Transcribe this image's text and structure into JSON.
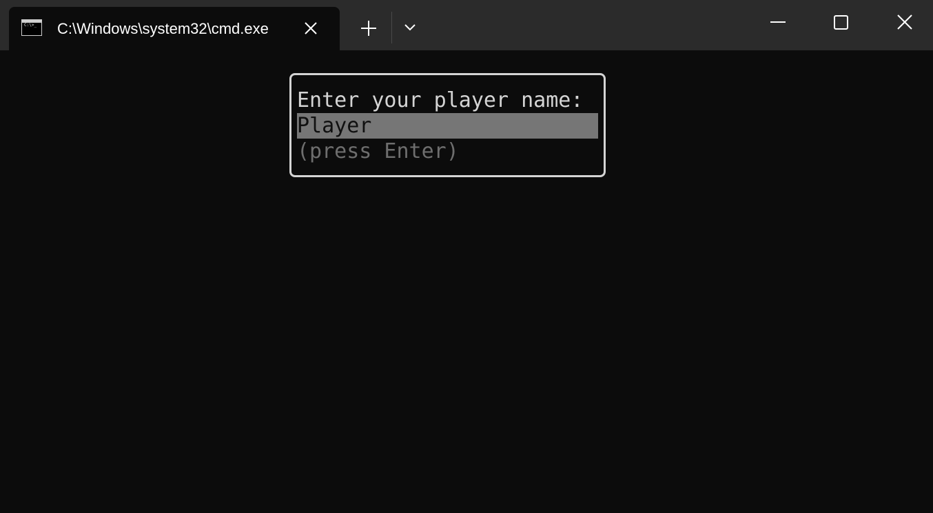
{
  "window": {
    "tab_title": "C:\\Windows\\system32\\cmd.exe",
    "tab_icon": "cmd-icon",
    "tab_icon_prompt": "C:\\>_",
    "new_tab_icon": "plus-icon",
    "dropdown_icon": "chevron-down-icon",
    "minimize_icon": "minimize-icon",
    "maximize_icon": "maximize-icon",
    "close_icon": "close-icon"
  },
  "terminal": {
    "prompt": "Enter your player name:",
    "input_value": "Player",
    "hint": "(press Enter)"
  },
  "colors": {
    "titlebar_bg": "#2b2b2b",
    "terminal_bg": "#0c0c0c",
    "dialog_border": "#d4d4d4",
    "input_highlight": "#767676",
    "hint_text": "#6e6e6e"
  }
}
